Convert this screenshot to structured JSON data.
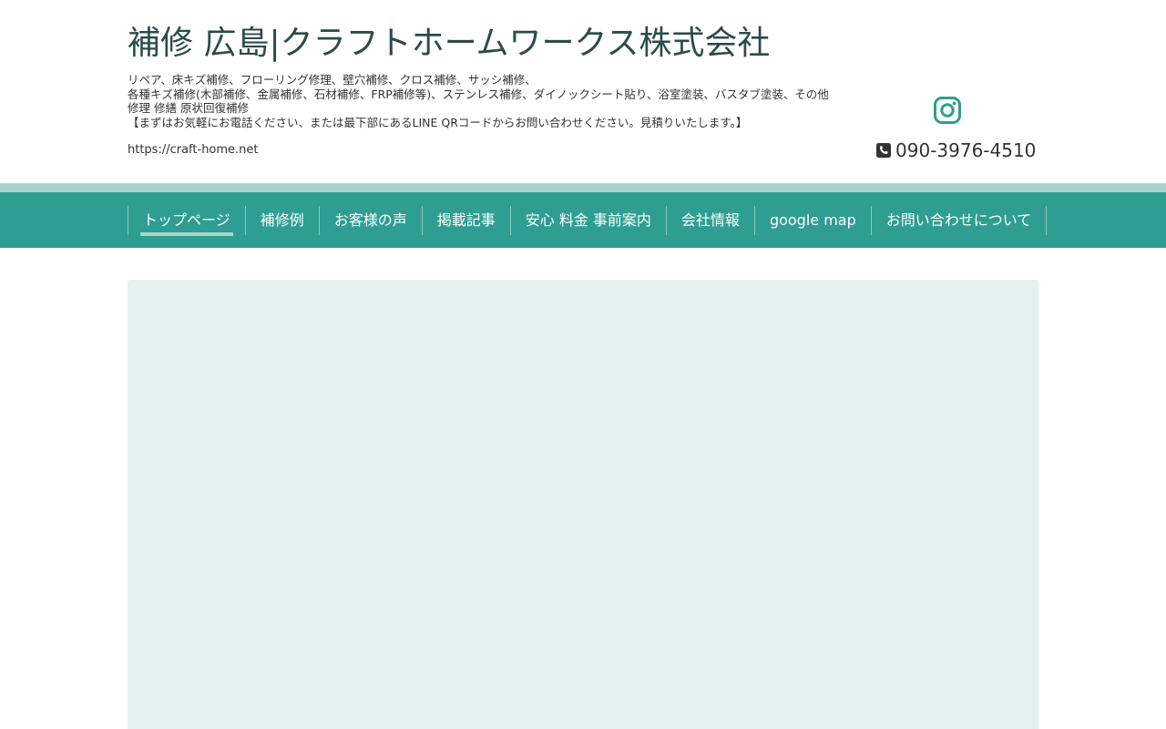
{
  "header": {
    "title": "補修 広島|クラフトホームワークス株式会社",
    "description_lines": [
      "リペア、床キズ補修、フローリング修理、壁穴補修、クロス補修、サッシ補修、",
      "各種キズ補修(木部補修、金属補修、石材補修、FRP補修等)、ステンレス補修、ダイノックシート貼り、浴室塗装、バスタブ塗装、その他 修理 修繕 原状回復補修",
      "【まずはお気軽にお電話ください、または最下部にあるLINE QRコードからお問い合わせください。見積りいたします。】"
    ],
    "url": "https://craft-home.net",
    "phone": "090-3976-4510",
    "instagram_icon": "instagram-icon",
    "phone_icon": "phone-square-icon"
  },
  "colors": {
    "nav_bg": "#2e9e92",
    "band": "#a8d4d0",
    "hero_bg": "#e3f2f1",
    "icon": "#2e9e92"
  },
  "nav": {
    "items": [
      {
        "label": "トップページ",
        "active": true
      },
      {
        "label": "補修例"
      },
      {
        "label": "お客様の声"
      },
      {
        "label": "掲載記事"
      },
      {
        "label": "安心 料金 事前案内"
      },
      {
        "label": "会社情報"
      },
      {
        "label": "google map"
      },
      {
        "label": "お問い合わせについて"
      }
    ]
  }
}
